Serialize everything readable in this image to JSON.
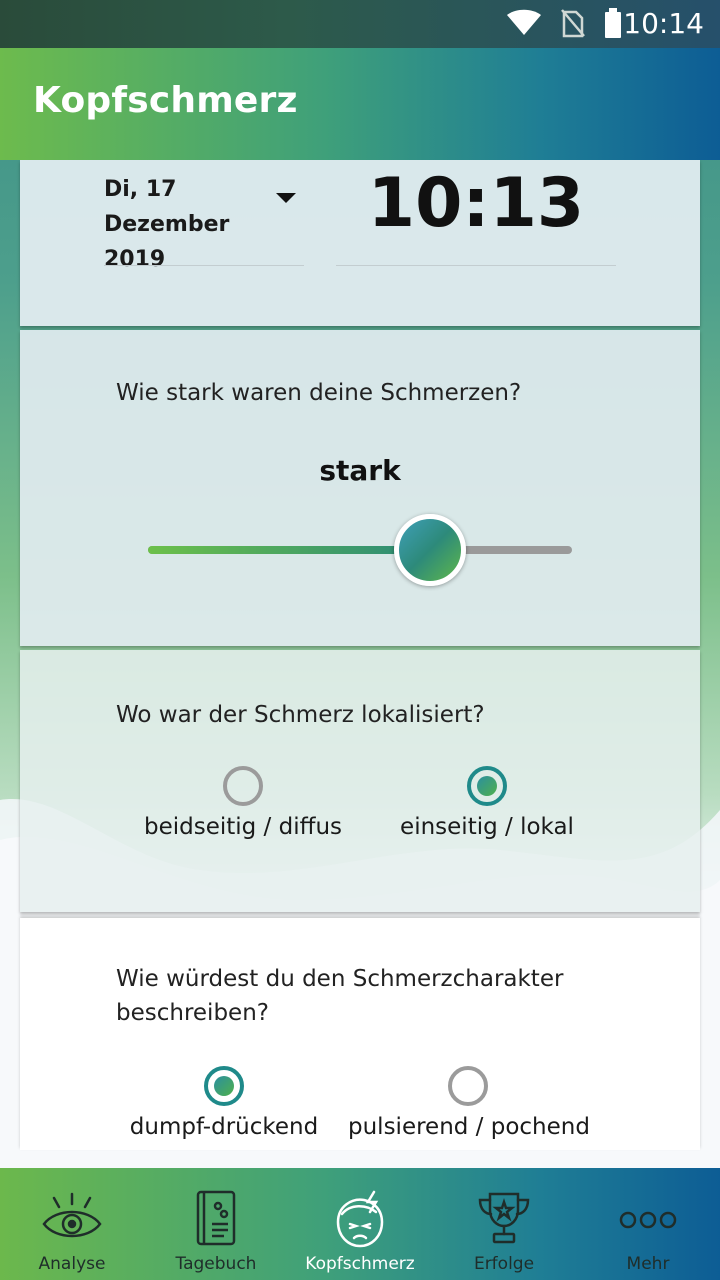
{
  "status_bar": {
    "time": "10:14"
  },
  "app_bar": {
    "title": "Kopfschmerz"
  },
  "date_time": {
    "date": "Di, 17 Dezember 2019",
    "time": "10:13"
  },
  "intensity": {
    "question": "Wie stark waren deine Schmerzen?",
    "value_label": "stark",
    "level_fraction": 0.665
  },
  "location": {
    "question": "Wo war der Schmerz lokalisiert?",
    "options": [
      {
        "label": "beidseitig / diffus",
        "selected": false
      },
      {
        "label": "einseitig / lokal",
        "selected": true
      }
    ]
  },
  "character": {
    "question": "Wie würdest du den Schmerzcharakter beschreiben?",
    "options": [
      {
        "label": "dumpf-drückend",
        "selected": true
      },
      {
        "label": "pulsierend / pochend",
        "selected": false
      }
    ]
  },
  "bottom_nav": {
    "items": [
      {
        "label": "Analyse",
        "icon": "eye-icon",
        "active": false
      },
      {
        "label": "Tagebuch",
        "icon": "diary-book-icon",
        "active": false
      },
      {
        "label": "Kopfschmerz",
        "icon": "headache-face-icon",
        "active": true
      },
      {
        "label": "Erfolge",
        "icon": "trophy-icon",
        "active": false
      },
      {
        "label": "Mehr",
        "icon": "more-dots-icon",
        "active": false
      }
    ]
  },
  "colors": {
    "accent_green": "#6cc04a",
    "accent_teal": "#1f8a8a",
    "accent_blue": "#0d5d95",
    "inactive_gray": "#9b9b9b"
  }
}
